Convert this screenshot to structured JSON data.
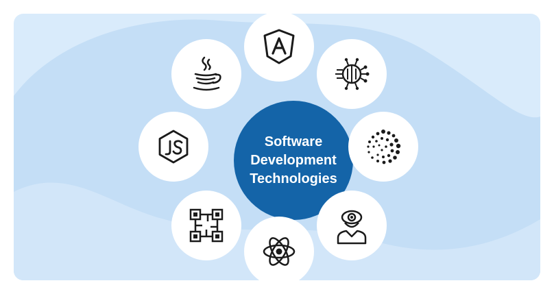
{
  "hub": {
    "title_lines": [
      "Software",
      "Development",
      "Technologies"
    ]
  },
  "nodes": [
    {
      "id": "angular",
      "icon": "angular-icon"
    },
    {
      "id": "ai-circuit",
      "icon": "ai-chip-icon"
    },
    {
      "id": "iota",
      "icon": "iota-dots-icon"
    },
    {
      "id": "vision-person",
      "icon": "eye-person-icon"
    },
    {
      "id": "atom",
      "icon": "atom-icon"
    },
    {
      "id": "qr-blocks",
      "icon": "qr-blocks-icon"
    },
    {
      "id": "nodejs",
      "icon": "nodejs-icon"
    },
    {
      "id": "java",
      "icon": "java-cup-icon"
    }
  ],
  "colors": {
    "background": "#d9ebfb",
    "blob": "#bfdcf5",
    "hub": "#1464a8",
    "node": "#ffffff",
    "icon": "#1a1a1a"
  }
}
